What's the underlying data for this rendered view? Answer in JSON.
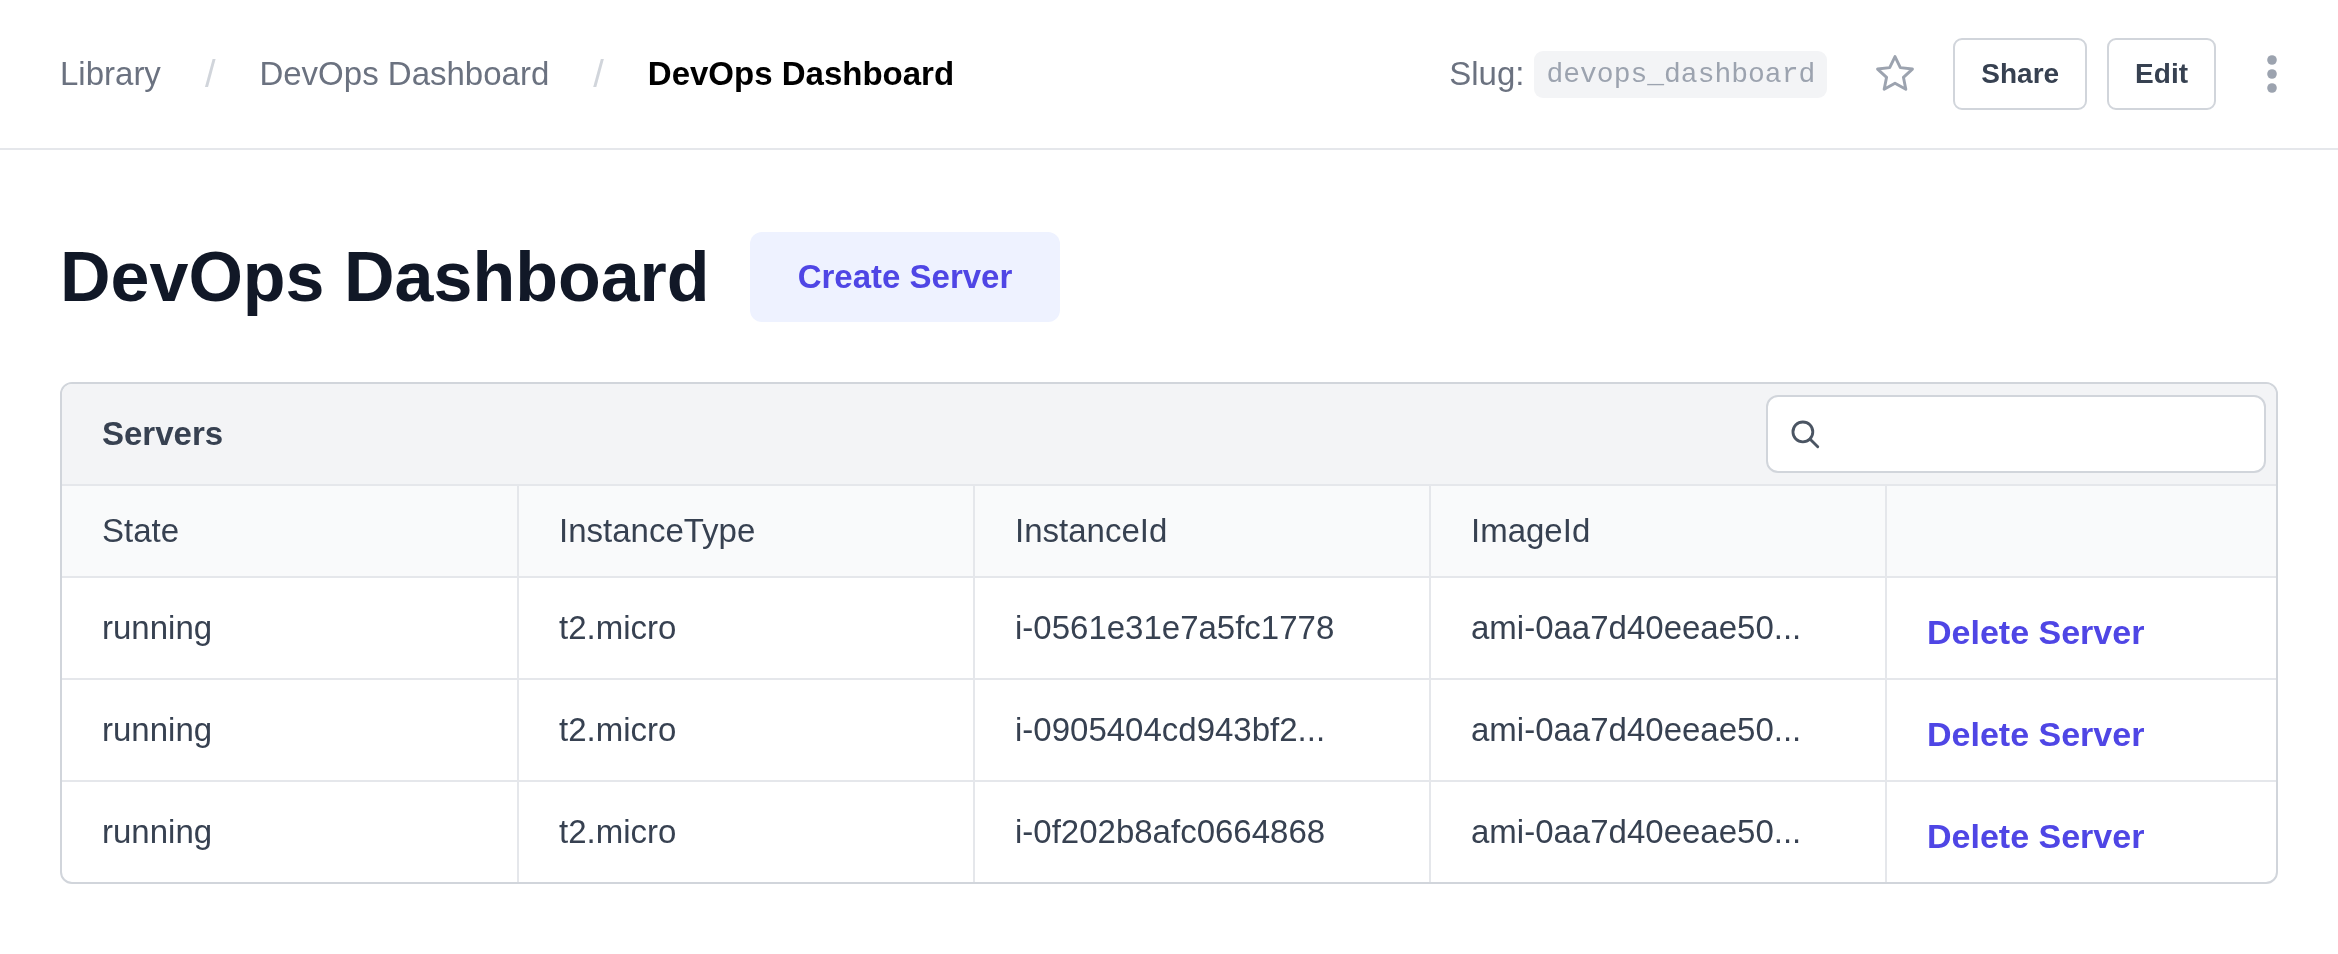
{
  "breadcrumbs": [
    {
      "label": "Library",
      "current": false
    },
    {
      "label": "DevOps Dashboard",
      "current": false
    },
    {
      "label": "DevOps Dashboard",
      "current": true
    }
  ],
  "breadcrumb_separator": "/",
  "slug": {
    "label": "Slug:",
    "value": "devops_dashboard"
  },
  "starred": false,
  "header_buttons": [
    "Share",
    "Edit"
  ],
  "page_title": "DevOps Dashboard",
  "primary_button": "Create Server",
  "table": {
    "title": "Servers",
    "columns": [
      "State",
      "InstanceType",
      "InstanceId",
      "ImageId"
    ],
    "rows": [
      {
        "cells": [
          "running",
          "t2.micro",
          "i-0561e31e7a5fc1778",
          "ami-0aa7d40eeae50..."
        ],
        "action": "Delete Server"
      },
      {
        "cells": [
          "running",
          "t2.micro",
          "i-0905404cd943bf2...",
          "ami-0aa7d40eeae50..."
        ],
        "action": "Delete Server"
      },
      {
        "cells": [
          "running",
          "t2.micro",
          "i-0f202b8afc0664868",
          "ami-0aa7d40eeae50..."
        ],
        "action": "Delete Server"
      }
    ]
  }
}
